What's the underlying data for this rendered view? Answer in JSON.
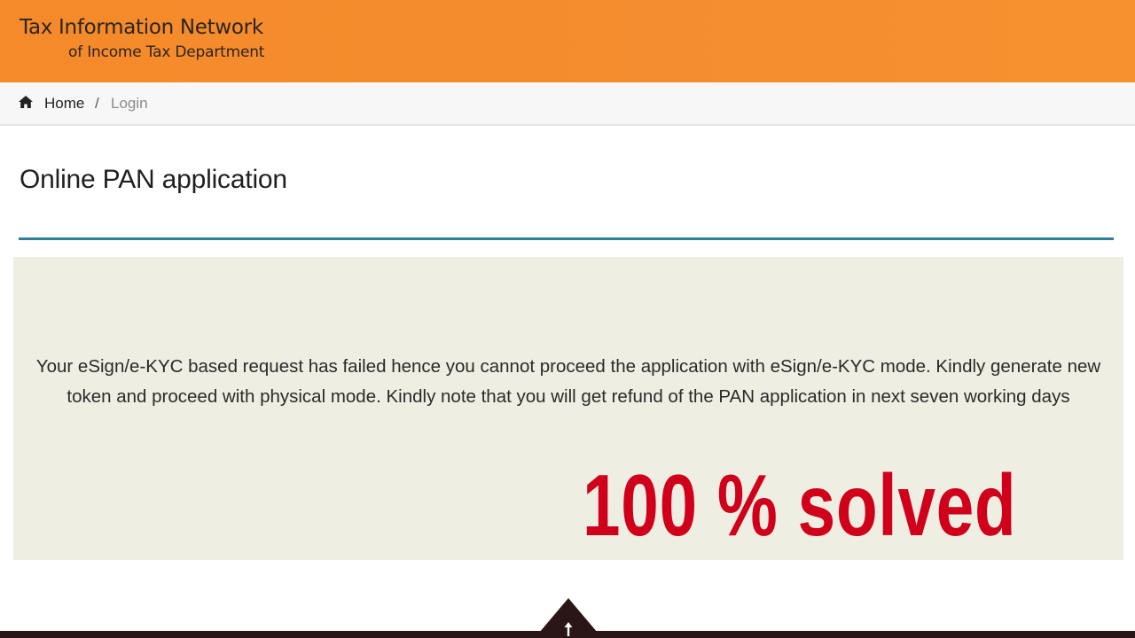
{
  "header": {
    "logo_line1": "Tax Information Network",
    "logo_line2": "of Income Tax Department"
  },
  "breadcrumb": {
    "home_icon": "home-icon",
    "home_label": "Home",
    "separator": "/",
    "current_label": "Login"
  },
  "page": {
    "title": "Online PAN application"
  },
  "message": {
    "text": "Your eSign/e-KYC based request has failed hence you cannot proceed the application with eSign/e-KYC mode. Kindly generate new token and proceed with physical mode. Kindly note that you will get refund of the PAN application in next seven working days"
  },
  "overlay": {
    "text": "100 % solved"
  },
  "footer": {
    "scroll_top_icon": "arrow-up-icon"
  },
  "colors": {
    "header_orange": "#f58a2a",
    "rule_teal": "#2f7f96",
    "panel_beige": "#efeee2",
    "overlay_red": "#d0001b",
    "footer_dark": "#2a1616"
  }
}
